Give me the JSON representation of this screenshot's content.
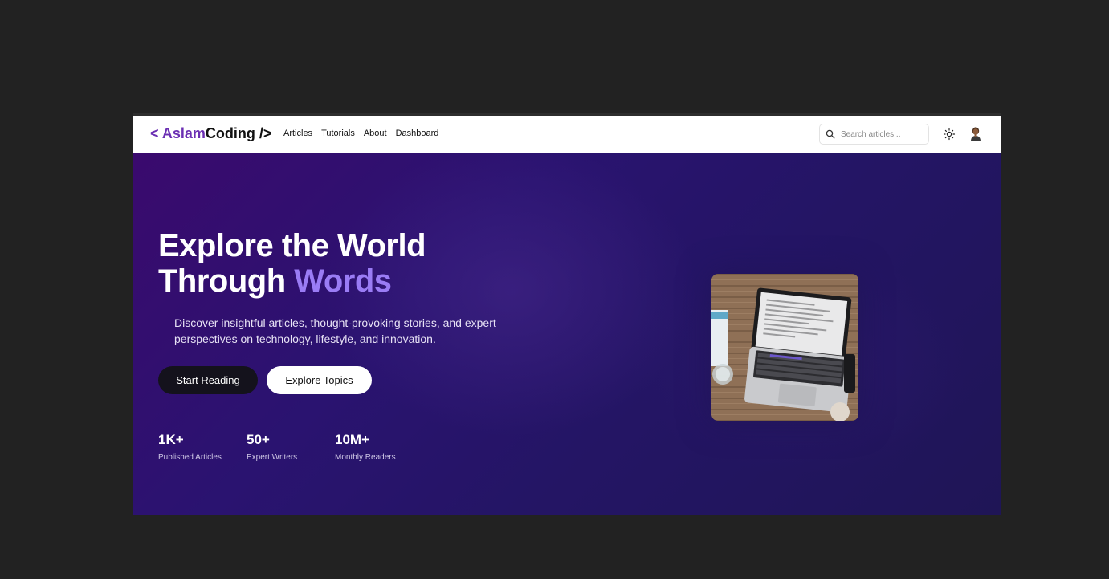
{
  "brand": {
    "open": "< ",
    "part1": "Aslam",
    "part2": "Coding",
    "close": " />"
  },
  "nav": {
    "items": [
      "Articles",
      "Tutorials",
      "About",
      "Dashboard"
    ]
  },
  "search": {
    "placeholder": "Search articles..."
  },
  "icons": {
    "search": "search-icon",
    "theme": "sun-icon",
    "avatar": "user-avatar"
  },
  "hero": {
    "title_line1": "Explore the World",
    "title_line2_plain": "Through ",
    "title_line2_accent": "Words",
    "subtitle": "Discover insightful articles, thought-provoking stories, and expert perspectives on technology, lifestyle, and innovation.",
    "primary_button": "Start Reading",
    "secondary_button": "Explore Topics"
  },
  "stats": [
    {
      "value": "1K+",
      "label": "Published Articles"
    },
    {
      "value": "50+",
      "label": "Expert Writers"
    },
    {
      "value": "10M+",
      "label": "Monthly Readers"
    }
  ],
  "colors": {
    "accent": "#6b2fb3",
    "headline_accent": "#9a7cf5",
    "hero_bg": "#241565"
  }
}
